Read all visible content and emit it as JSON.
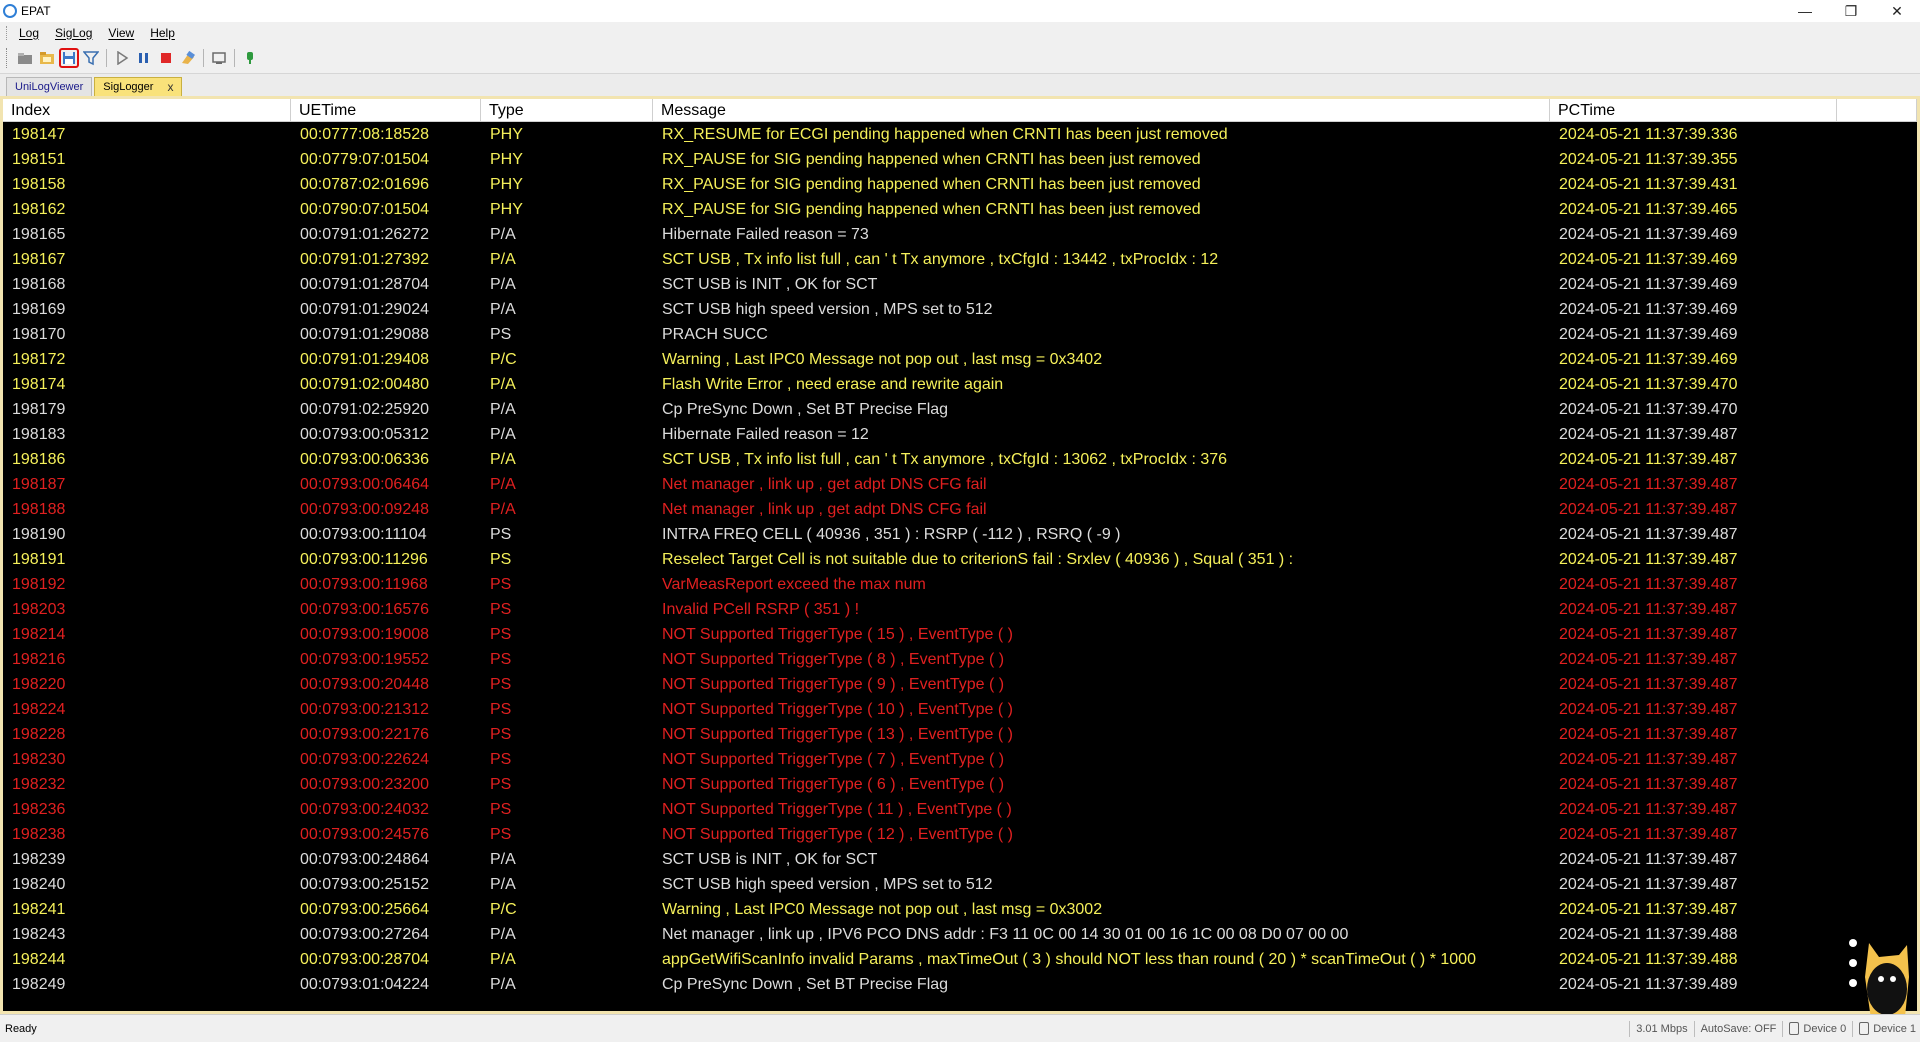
{
  "window": {
    "title": "EPAT"
  },
  "menu": {
    "items": [
      "Log",
      "SigLog",
      "View",
      "Help"
    ]
  },
  "tabs": [
    {
      "label": "UniLogViewer"
    },
    {
      "label": "SigLogger",
      "close": "x"
    }
  ],
  "table": {
    "columns": [
      "Index",
      "UETime",
      "Type",
      "Message",
      "PCTime"
    ],
    "rows": [
      {
        "index": "198147",
        "uetime": "00:0777:08:18528",
        "type": "PHY",
        "message": "RX_RESUME for ECGI pending happened when CRNTI has been just removed",
        "pctime": "2024-05-21 11:37:39.336",
        "level": "warn"
      },
      {
        "index": "198151",
        "uetime": "00:0779:07:01504",
        "type": "PHY",
        "message": "RX_PAUSE for SIG pending happened when CRNTI has been just removed",
        "pctime": "2024-05-21 11:37:39.355",
        "level": "warn"
      },
      {
        "index": "198158",
        "uetime": "00:0787:02:01696",
        "type": "PHY",
        "message": "RX_PAUSE for SIG pending happened when CRNTI has been just removed",
        "pctime": "2024-05-21 11:37:39.431",
        "level": "warn"
      },
      {
        "index": "198162",
        "uetime": "00:0790:07:01504",
        "type": "PHY",
        "message": "RX_PAUSE for SIG pending happened when CRNTI has been just removed",
        "pctime": "2024-05-21 11:37:39.465",
        "level": "warn"
      },
      {
        "index": "198165",
        "uetime": "00:0791:01:26272",
        "type": "P/A",
        "message": "Hibernate Failed reason = 73",
        "pctime": "2024-05-21 11:37:39.469",
        "level": "info"
      },
      {
        "index": "198167",
        "uetime": "00:0791:01:27392",
        "type": "P/A",
        "message": "SCT USB , Tx info list full , can ' t Tx anymore , txCfgId : 13442 , txProcIdx : 12",
        "pctime": "2024-05-21 11:37:39.469",
        "level": "warn"
      },
      {
        "index": "198168",
        "uetime": "00:0791:01:28704",
        "type": "P/A",
        "message": "SCT USB is INIT , OK for SCT",
        "pctime": "2024-05-21 11:37:39.469",
        "level": "info"
      },
      {
        "index": "198169",
        "uetime": "00:0791:01:29024",
        "type": "P/A",
        "message": "SCT USB high speed version , MPS set to 512",
        "pctime": "2024-05-21 11:37:39.469",
        "level": "info"
      },
      {
        "index": "198170",
        "uetime": "00:0791:01:29088",
        "type": "PS",
        "message": "PRACH SUCC",
        "pctime": "2024-05-21 11:37:39.469",
        "level": "info"
      },
      {
        "index": "198172",
        "uetime": "00:0791:01:29408",
        "type": "P/C",
        "message": "Warning , Last IPC0 Message not pop out , last msg = 0x3402",
        "pctime": "2024-05-21 11:37:39.469",
        "level": "warn"
      },
      {
        "index": "198174",
        "uetime": "00:0791:02:00480",
        "type": "P/A",
        "message": "Flash Write Error , need erase and rewrite again",
        "pctime": "2024-05-21 11:37:39.470",
        "level": "warn"
      },
      {
        "index": "198179",
        "uetime": "00:0791:02:25920",
        "type": "P/A",
        "message": "Cp PreSync Down , Set BT Precise Flag",
        "pctime": "2024-05-21 11:37:39.470",
        "level": "info"
      },
      {
        "index": "198183",
        "uetime": "00:0793:00:05312",
        "type": "P/A",
        "message": "Hibernate Failed reason = 12",
        "pctime": "2024-05-21 11:37:39.487",
        "level": "info"
      },
      {
        "index": "198186",
        "uetime": "00:0793:00:06336",
        "type": "P/A",
        "message": "SCT USB , Tx info list full , can ' t Tx anymore , txCfgId : 13062 , txProcIdx : 376",
        "pctime": "2024-05-21 11:37:39.487",
        "level": "warn"
      },
      {
        "index": "198187",
        "uetime": "00:0793:00:06464",
        "type": "P/A",
        "message": "Net manager , link up , get adpt DNS CFG fail",
        "pctime": "2024-05-21 11:37:39.487",
        "level": "error"
      },
      {
        "index": "198188",
        "uetime": "00:0793:00:09248",
        "type": "P/A",
        "message": "Net manager , link up , get adpt DNS CFG fail",
        "pctime": "2024-05-21 11:37:39.487",
        "level": "error"
      },
      {
        "index": "198190",
        "uetime": "00:0793:00:11104",
        "type": "PS",
        "message": "INTRA FREQ CELL ( 40936 , 351 ) : RSRP ( -112 ) , RSRQ ( -9 )",
        "pctime": "2024-05-21 11:37:39.487",
        "level": "info"
      },
      {
        "index": "198191",
        "uetime": "00:0793:00:11296",
        "type": "PS",
        "message": "Reselect Target Cell is not suitable due to criterionS fail : Srxlev ( 40936 ) , Squal ( 351 ) :",
        "pctime": "2024-05-21 11:37:39.487",
        "level": "warn"
      },
      {
        "index": "198192",
        "uetime": "00:0793:00:11968",
        "type": "PS",
        "message": "VarMeasReport exceed the max num",
        "pctime": "2024-05-21 11:37:39.487",
        "level": "error"
      },
      {
        "index": "198203",
        "uetime": "00:0793:00:16576",
        "type": "PS",
        "message": "Invalid PCell RSRP ( 351 ) !",
        "pctime": "2024-05-21 11:37:39.487",
        "level": "error"
      },
      {
        "index": "198214",
        "uetime": "00:0793:00:19008",
        "type": "PS",
        "message": "NOT Supported TriggerType ( 15 ) , EventType (  )",
        "pctime": "2024-05-21 11:37:39.487",
        "level": "error"
      },
      {
        "index": "198216",
        "uetime": "00:0793:00:19552",
        "type": "PS",
        "message": "NOT Supported TriggerType ( 8 ) , EventType (  )",
        "pctime": "2024-05-21 11:37:39.487",
        "level": "error"
      },
      {
        "index": "198220",
        "uetime": "00:0793:00:20448",
        "type": "PS",
        "message": "NOT Supported TriggerType ( 9 ) , EventType (  )",
        "pctime": "2024-05-21 11:37:39.487",
        "level": "error"
      },
      {
        "index": "198224",
        "uetime": "00:0793:00:21312",
        "type": "PS",
        "message": "NOT Supported TriggerType ( 10 ) , EventType (  )",
        "pctime": "2024-05-21 11:37:39.487",
        "level": "error"
      },
      {
        "index": "198228",
        "uetime": "00:0793:00:22176",
        "type": "PS",
        "message": "NOT Supported TriggerType ( 13 ) , EventType (  )",
        "pctime": "2024-05-21 11:37:39.487",
        "level": "error"
      },
      {
        "index": "198230",
        "uetime": "00:0793:00:22624",
        "type": "PS",
        "message": "NOT Supported TriggerType ( 7 ) , EventType (  )",
        "pctime": "2024-05-21 11:37:39.487",
        "level": "error"
      },
      {
        "index": "198232",
        "uetime": "00:0793:00:23200",
        "type": "PS",
        "message": "NOT Supported TriggerType ( 6 ) , EventType (  )",
        "pctime": "2024-05-21 11:37:39.487",
        "level": "error"
      },
      {
        "index": "198236",
        "uetime": "00:0793:00:24032",
        "type": "PS",
        "message": "NOT Supported TriggerType ( 11 ) , EventType (  )",
        "pctime": "2024-05-21 11:37:39.487",
        "level": "error"
      },
      {
        "index": "198238",
        "uetime": "00:0793:00:24576",
        "type": "PS",
        "message": "NOT Supported TriggerType ( 12 ) , EventType (  )",
        "pctime": "2024-05-21 11:37:39.487",
        "level": "error"
      },
      {
        "index": "198239",
        "uetime": "00:0793:00:24864",
        "type": "P/A",
        "message": "SCT USB is INIT , OK for SCT",
        "pctime": "2024-05-21 11:37:39.487",
        "level": "info"
      },
      {
        "index": "198240",
        "uetime": "00:0793:00:25152",
        "type": "P/A",
        "message": "SCT USB high speed version , MPS set to 512",
        "pctime": "2024-05-21 11:37:39.487",
        "level": "info"
      },
      {
        "index": "198241",
        "uetime": "00:0793:00:25664",
        "type": "P/C",
        "message": "Warning , Last IPC0 Message not pop out , last msg = 0x3002",
        "pctime": "2024-05-21 11:37:39.487",
        "level": "warn"
      },
      {
        "index": "198243",
        "uetime": "00:0793:00:27264",
        "type": "P/A",
        "message": "Net manager , link up , IPV6 PCO DNS addr : F3 11 0C 00 14 30 01 00 16 1C 00 08 D0 07 00 00",
        "pctime": "2024-05-21 11:37:39.488",
        "level": "info"
      },
      {
        "index": "198244",
        "uetime": "00:0793:00:28704",
        "type": "P/A",
        "message": "appGetWifiScanInfo invalid Params , maxTimeOut ( 3 ) should NOT less than round ( 20 ) * scanTimeOut (  ) * 1000",
        "pctime": "2024-05-21 11:37:39.488",
        "level": "warn"
      },
      {
        "index": "198249",
        "uetime": "00:0793:01:04224",
        "type": "P/A",
        "message": "Cp PreSync Down , Set BT Precise Flag",
        "pctime": "2024-05-21 11:37:39.489",
        "level": "info"
      }
    ]
  },
  "colors": {
    "info": "#dcdcdc",
    "warn": "#f5f05a",
    "error": "#e02020"
  },
  "toolbar": {
    "buttons": [
      "open-icon",
      "folder-icon",
      "save-icon",
      "filter-icon",
      "play-icon",
      "pause-icon",
      "stop-icon",
      "clear-icon",
      "device-icon",
      "connect-icon"
    ]
  },
  "status": {
    "left": "Ready",
    "rate": "3.01 Mbps",
    "autosave": "AutoSave: OFF",
    "device0": "Device 0",
    "device1": "Device 1"
  }
}
